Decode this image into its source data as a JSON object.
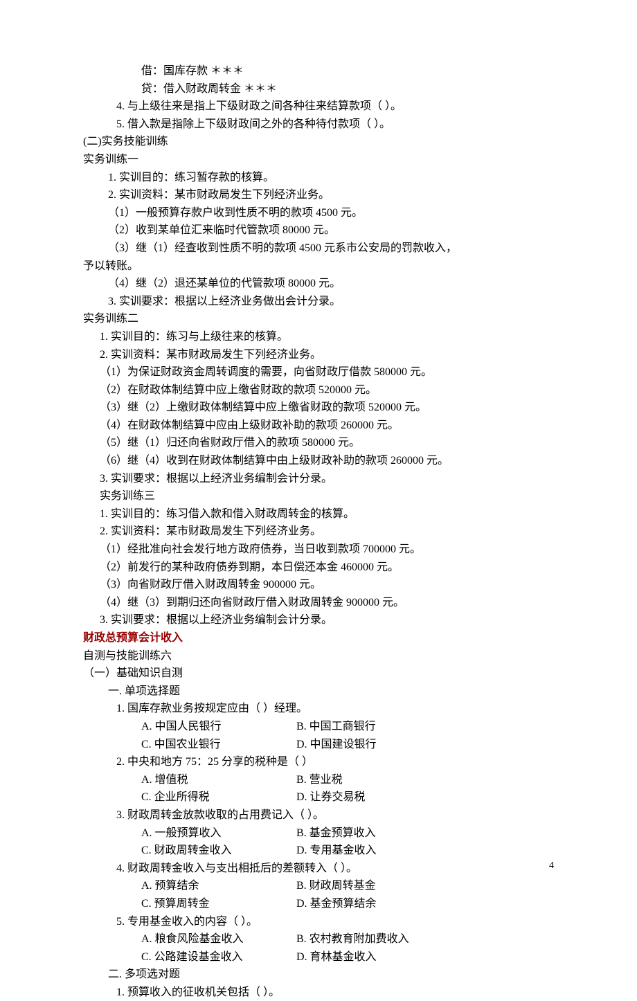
{
  "entry1": "借：国库存款                ＊＊＊",
  "entry2": "    贷：借入财政周转金        ＊＊＊",
  "tf4": "4. 与上级往来是指上下级财政之间各种往来结算款项（   ）。",
  "tf5": "5. 借入款是指除上下级财政间之外的各种待付款项（  ）。",
  "sec2": "(二)实务技能训练",
  "ex1_title": "实务训练一",
  "ex1_1": "1. 实训目的：练习暂存款的核算。",
  "ex1_2": "2. 实训资料：某市财政局发生下列经济业务。",
  "ex1_2_1": "（1）一般预算存款户收到性质不明的款项 4500 元。",
  "ex1_2_2": "（2）收到某单位汇来临时代管款项 80000 元。",
  "ex1_2_3a": "（3）继（1）经查收到性质不明的款项 4500 元系市公安局的罚款收入，",
  "ex1_2_3b": "予以转账。",
  "ex1_2_4": "（4）继（2）退还某单位的代管款项 80000 元。",
  "ex1_3": "  3. 实训要求：根据以上经济业务做出会计分录。",
  "ex2_title": "实务训练二",
  "ex2_1": "1. 实训目的：练习与上级往来的核算。",
  "ex2_2": "2. 实训资料：某市财政局发生下列经济业务。",
  "ex2_2_1": "（1）为保证财政资金周转调度的需要，向省财政厅借款 580000 元。",
  "ex2_2_2": "（2）在财政体制结算中应上缴省财政的款项 520000 元。",
  "ex2_2_3": "（3）继（2）上缴财政体制结算中应上缴省财政的款项 520000 元。",
  "ex2_2_4": "（4）在财政体制结算中应由上级财政补助的款项 260000 元。",
  "ex2_2_5": "（5）继（1）归还向省财政厅借入的款项 580000 元。",
  "ex2_2_6": "（6）继（4）收到在财政体制结算中由上级财政补助的款项 260000 元。",
  "ex2_3": "3. 实训要求：根据以上经济业务编制会计分录。",
  "ex3_title": " 实务训练三",
  "ex3_1": " 1. 实训目的：练习借入款和借入财政周转金的核算。",
  "ex3_2": " 2. 实训资料：某市财政局发生下列经济业务。",
  "ex3_2_1": "（1）经批准向社会发行地方政府债券，当日收到款项 700000 元。",
  "ex3_2_2": "（2）前发行的某种政府债券到期，本日偿还本金 460000 元。",
  "ex3_2_3": "（3）向省财政厅借入财政周转金 900000 元。",
  "ex3_2_4": "（4）继（3）到期归还向省财政厅借入财政周转金 900000 元。",
  "ex3_3": " 3. 实训要求：根据以上经济业务编制会计分录。",
  "chapter": "财政总预算会计收入",
  "self6": "自测与技能训练六",
  "part1": "（一）基础知识自测",
  "mcq_h": "一. 单项选择题",
  "q1": "1. 国库存款业务按规定应由（    ）经理。",
  "q1a": "A. 中国人民银行",
  "q1b": "B. 中国工商银行",
  "q1c": "C. 中国农业银行",
  "q1d": "D. 中国建设银行",
  "q2": "2. 中央和地方 75：25 分享的税种是（     ）",
  "q2a": "A. 增值税",
  "q2b": "B. 营业税",
  "q2c": "C. 企业所得税",
  "q2d": "D. 让券交易税",
  "q3": "3. 财政周转金放款收取的占用费记入（     ）。",
  "q3a": "A. 一般预算收入",
  "q3b": "B. 基金预算收入",
  "q3c": "C. 财政周转金收入",
  "q3d": "D. 专用基金收入",
  "q4": "4. 财政周转金收入与支出相抵后的差额转入（     ）。",
  "q4a": "A. 预算结余",
  "q4b": "B. 财政周转基金",
  "q4c": "C. 预算周转金",
  "q4d": "D. 基金预算结余",
  "q5": "5. 专用基金收入的内容（    ）。",
  "q5a": "A. 粮食风险基金收入",
  "q5b": "B. 农村教育附加费收入",
  "q5c": "C. 公路建设基金收入",
  "q5d": "D. 育林基金收入",
  "mmc_h": "二. 多项选对题",
  "mq1": "1. 预算收入的征收机关包括（   ）。",
  "pagenum": "4"
}
